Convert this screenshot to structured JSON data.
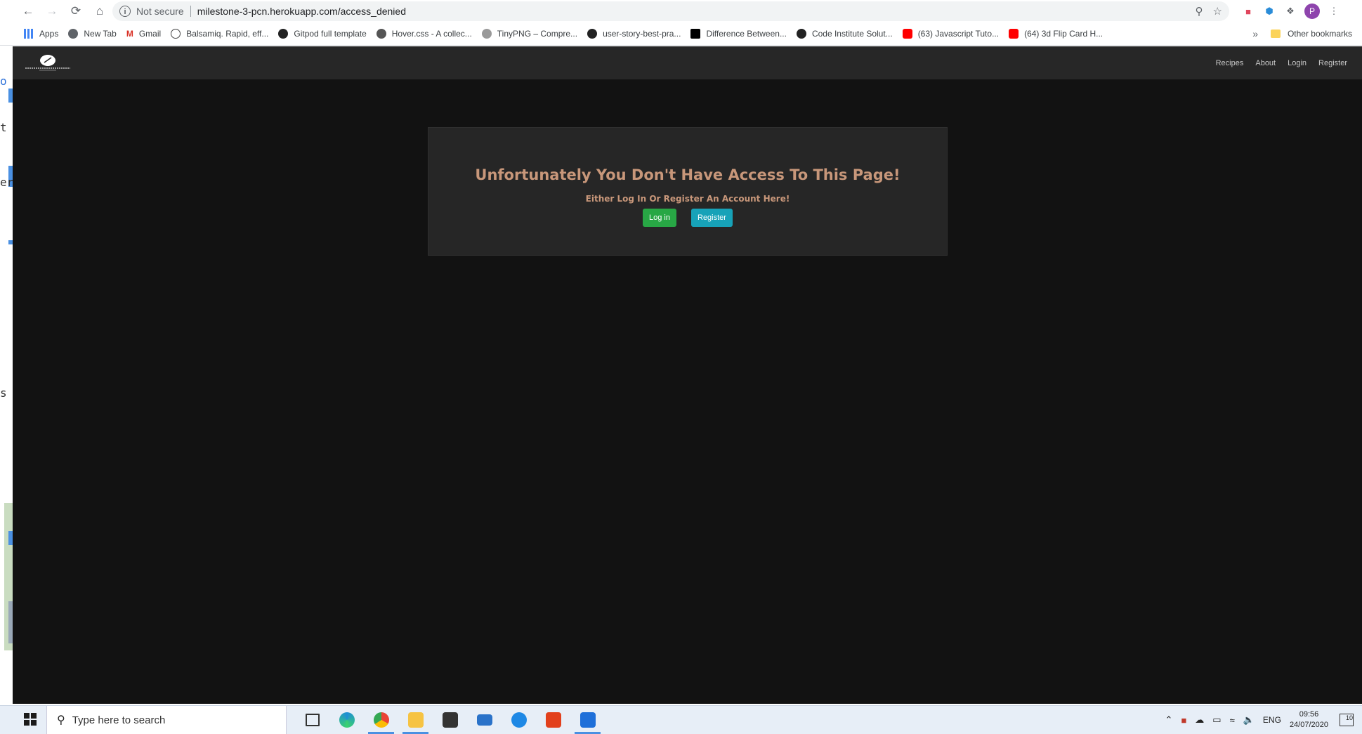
{
  "browser": {
    "security_label": "Not secure",
    "url": "milestone-3-pcn.herokuapp.com/access_denied",
    "profile_initial": "P",
    "bookmarks": [
      {
        "label": "Apps",
        "color": "#4285f4"
      },
      {
        "label": "New Tab",
        "color": "#5f6368"
      },
      {
        "label": "Gmail",
        "color": "#d93025"
      },
      {
        "label": "Balsamiq. Rapid, eff...",
        "color": "#444444"
      },
      {
        "label": "Gitpod full template",
        "color": "#222222"
      },
      {
        "label": "Hover.css - A collec...",
        "color": "#555555"
      },
      {
        "label": "TinyPNG – Compre...",
        "color": "#777777"
      },
      {
        "label": "user-story-best-pra...",
        "color": "#222222"
      },
      {
        "label": "Difference Between...",
        "color": "#000000"
      },
      {
        "label": "Code Institute Solut...",
        "color": "#222222"
      },
      {
        "label": "(63) Javascript Tuto...",
        "color": "#ff0000"
      },
      {
        "label": "(64) 3d Flip Card H...",
        "color": "#ff0000"
      }
    ],
    "more_label": "»",
    "other_bookmarks": "Other bookmarks"
  },
  "site": {
    "nav": [
      "Recipes",
      "About",
      "Login",
      "Register"
    ],
    "heading": "Unfortunately You Don't Have Access To This Page!",
    "subheading": "Either Log In Or Register An Account Here!",
    "login_button": "Log in",
    "register_button": "Register",
    "heading_color": "#c8977a",
    "login_color": "#28a745",
    "register_color": "#17a2b8"
  },
  "taskbar": {
    "search_placeholder": "Type here to search",
    "language": "ENG",
    "time": "09:56",
    "date": "24/07/2020",
    "notifications": "10",
    "apps": [
      "task-view",
      "edge",
      "chrome",
      "file-explorer",
      "store",
      "mail",
      "cortana",
      "office",
      "snip"
    ]
  },
  "left_window": {
    "fragments": [
      "o",
      "t",
      "er",
      "s"
    ]
  },
  "desktop_zero": "0"
}
